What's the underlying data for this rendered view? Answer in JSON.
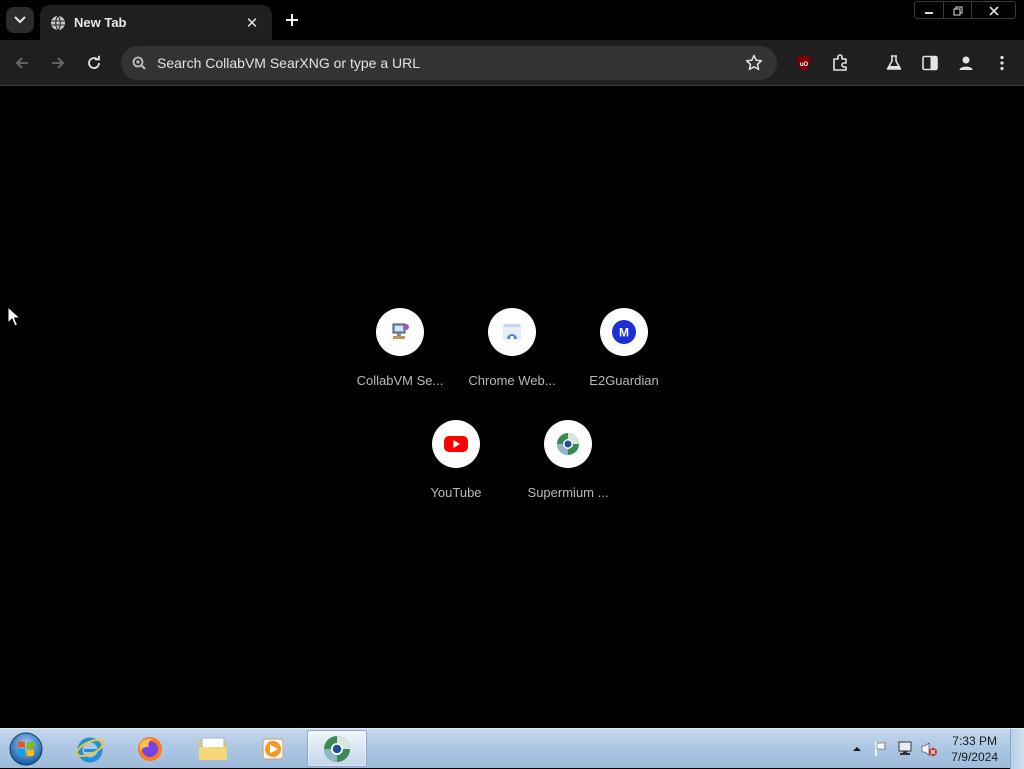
{
  "browser": {
    "tab": {
      "title": "New Tab",
      "icon": "globe-icon"
    },
    "omnibox": {
      "placeholder": "Search CollabVM SearXNG or type a URL",
      "icon": "searxng-icon"
    },
    "toolbar_icons": [
      "back-icon",
      "forward-icon",
      "reload-icon",
      "bookmark-star-icon",
      "ublock-icon",
      "extensions-icon",
      "labs-flask-icon",
      "side-panel-icon",
      "profile-icon",
      "menu-icon"
    ]
  },
  "shortcuts": [
    {
      "label": "CollabVM Se...",
      "icon": "collabvm-icon"
    },
    {
      "label": "Chrome Web...",
      "icon": "chrome-web-store-icon"
    },
    {
      "label": "E2Guardian",
      "icon": "e2guardian-icon",
      "letter": "M"
    },
    {
      "label": "YouTube",
      "icon": "youtube-icon"
    },
    {
      "label": "Supermium ...",
      "icon": "supermium-icon"
    }
  ],
  "taskbar": {
    "apps": [
      "internet-explorer-icon",
      "firefox-icon",
      "file-explorer-icon",
      "media-player-icon",
      "supermium-icon"
    ],
    "clock": {
      "time": "7:33 PM",
      "date": "7/9/2024"
    }
  },
  "colors": {
    "chrome_bg": "#1f1f1f",
    "omnibox_bg": "#333333",
    "content_bg": "#000000",
    "e2guardian_blue": "#1a2fd4",
    "youtube_red": "#ff0000"
  }
}
